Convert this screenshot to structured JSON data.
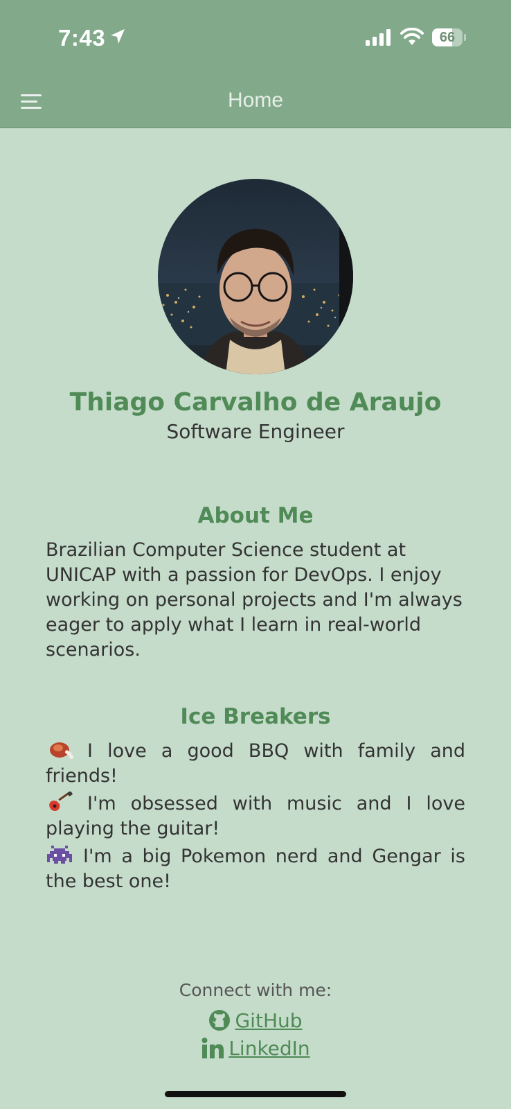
{
  "status_bar": {
    "time": "7:43",
    "battery_level": "66",
    "battery_fraction": 0.66
  },
  "header": {
    "title": "Home",
    "menu_icon": "hamburger-menu-icon"
  },
  "profile": {
    "name": "Thiago Carvalho de Araujo",
    "role": "Software Engineer"
  },
  "about": {
    "heading": "About Me",
    "lines": [
      "Brazilian Computer Science student at",
      "UNICAP with a passion for DevOps. I enjoy",
      "working on personal projects and I'm always",
      "eager to apply what I learn in real-world",
      "scenarios."
    ]
  },
  "ice_breakers": {
    "heading": "Ice Breakers",
    "items": [
      {
        "icon": "meat-on-bone-icon",
        "line1": "I love a good BBQ with family and",
        "line2": "friends!"
      },
      {
        "icon": "guitar-icon",
        "line1": "I'm obsessed with music and I love",
        "line2": "playing the guitar!"
      },
      {
        "icon": "alien-monster-icon",
        "line1": "I'm a big Pokemon nerd and Gengar is",
        "line2": "the best one!"
      }
    ]
  },
  "connect": {
    "label": "Connect with me:",
    "github": {
      "icon": "github-icon",
      "label": "GitHub"
    },
    "linkedin": {
      "icon": "linkedin-icon",
      "label": "LinkedIn"
    }
  },
  "colors": {
    "header_bg": "#81a98a",
    "page_bg": "#c5dcca",
    "accent": "#4f8a57"
  }
}
